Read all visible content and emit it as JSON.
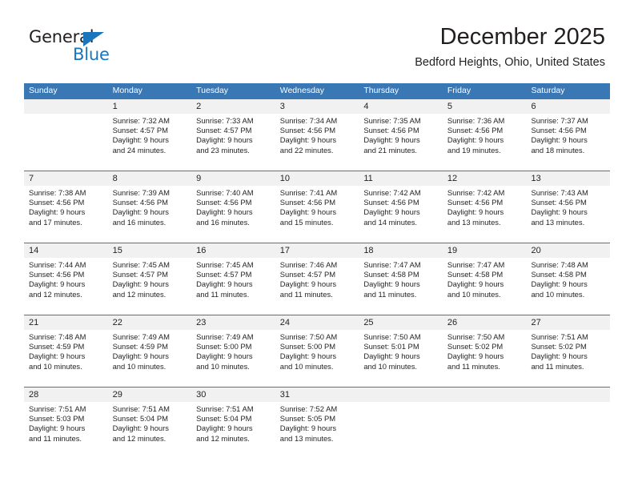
{
  "brand": {
    "name_part1": "General",
    "name_part2": "Blue"
  },
  "header": {
    "month_title": "December 2025",
    "location": "Bedford Heights, Ohio, United States"
  },
  "colors": {
    "header_blue": "#3a77b5",
    "brand_blue": "#1b75bc",
    "day_band_gray": "#f1f1f1",
    "text": "#231f20"
  },
  "calendar": {
    "day_headers": [
      "Sunday",
      "Monday",
      "Tuesday",
      "Wednesday",
      "Thursday",
      "Friday",
      "Saturday"
    ],
    "weeks": [
      [
        {
          "day": "",
          "sunrise": "",
          "sunset": "",
          "daylight_line1": "",
          "daylight_line2": ""
        },
        {
          "day": "1",
          "sunrise": "Sunrise: 7:32 AM",
          "sunset": "Sunset: 4:57 PM",
          "daylight_line1": "Daylight: 9 hours",
          "daylight_line2": "and 24 minutes."
        },
        {
          "day": "2",
          "sunrise": "Sunrise: 7:33 AM",
          "sunset": "Sunset: 4:57 PM",
          "daylight_line1": "Daylight: 9 hours",
          "daylight_line2": "and 23 minutes."
        },
        {
          "day": "3",
          "sunrise": "Sunrise: 7:34 AM",
          "sunset": "Sunset: 4:56 PM",
          "daylight_line1": "Daylight: 9 hours",
          "daylight_line2": "and 22 minutes."
        },
        {
          "day": "4",
          "sunrise": "Sunrise: 7:35 AM",
          "sunset": "Sunset: 4:56 PM",
          "daylight_line1": "Daylight: 9 hours",
          "daylight_line2": "and 21 minutes."
        },
        {
          "day": "5",
          "sunrise": "Sunrise: 7:36 AM",
          "sunset": "Sunset: 4:56 PM",
          "daylight_line1": "Daylight: 9 hours",
          "daylight_line2": "and 19 minutes."
        },
        {
          "day": "6",
          "sunrise": "Sunrise: 7:37 AM",
          "sunset": "Sunset: 4:56 PM",
          "daylight_line1": "Daylight: 9 hours",
          "daylight_line2": "and 18 minutes."
        }
      ],
      [
        {
          "day": "7",
          "sunrise": "Sunrise: 7:38 AM",
          "sunset": "Sunset: 4:56 PM",
          "daylight_line1": "Daylight: 9 hours",
          "daylight_line2": "and 17 minutes."
        },
        {
          "day": "8",
          "sunrise": "Sunrise: 7:39 AM",
          "sunset": "Sunset: 4:56 PM",
          "daylight_line1": "Daylight: 9 hours",
          "daylight_line2": "and 16 minutes."
        },
        {
          "day": "9",
          "sunrise": "Sunrise: 7:40 AM",
          "sunset": "Sunset: 4:56 PM",
          "daylight_line1": "Daylight: 9 hours",
          "daylight_line2": "and 16 minutes."
        },
        {
          "day": "10",
          "sunrise": "Sunrise: 7:41 AM",
          "sunset": "Sunset: 4:56 PM",
          "daylight_line1": "Daylight: 9 hours",
          "daylight_line2": "and 15 minutes."
        },
        {
          "day": "11",
          "sunrise": "Sunrise: 7:42 AM",
          "sunset": "Sunset: 4:56 PM",
          "daylight_line1": "Daylight: 9 hours",
          "daylight_line2": "and 14 minutes."
        },
        {
          "day": "12",
          "sunrise": "Sunrise: 7:42 AM",
          "sunset": "Sunset: 4:56 PM",
          "daylight_line1": "Daylight: 9 hours",
          "daylight_line2": "and 13 minutes."
        },
        {
          "day": "13",
          "sunrise": "Sunrise: 7:43 AM",
          "sunset": "Sunset: 4:56 PM",
          "daylight_line1": "Daylight: 9 hours",
          "daylight_line2": "and 13 minutes."
        }
      ],
      [
        {
          "day": "14",
          "sunrise": "Sunrise: 7:44 AM",
          "sunset": "Sunset: 4:56 PM",
          "daylight_line1": "Daylight: 9 hours",
          "daylight_line2": "and 12 minutes."
        },
        {
          "day": "15",
          "sunrise": "Sunrise: 7:45 AM",
          "sunset": "Sunset: 4:57 PM",
          "daylight_line1": "Daylight: 9 hours",
          "daylight_line2": "and 12 minutes."
        },
        {
          "day": "16",
          "sunrise": "Sunrise: 7:45 AM",
          "sunset": "Sunset: 4:57 PM",
          "daylight_line1": "Daylight: 9 hours",
          "daylight_line2": "and 11 minutes."
        },
        {
          "day": "17",
          "sunrise": "Sunrise: 7:46 AM",
          "sunset": "Sunset: 4:57 PM",
          "daylight_line1": "Daylight: 9 hours",
          "daylight_line2": "and 11 minutes."
        },
        {
          "day": "18",
          "sunrise": "Sunrise: 7:47 AM",
          "sunset": "Sunset: 4:58 PM",
          "daylight_line1": "Daylight: 9 hours",
          "daylight_line2": "and 11 minutes."
        },
        {
          "day": "19",
          "sunrise": "Sunrise: 7:47 AM",
          "sunset": "Sunset: 4:58 PM",
          "daylight_line1": "Daylight: 9 hours",
          "daylight_line2": "and 10 minutes."
        },
        {
          "day": "20",
          "sunrise": "Sunrise: 7:48 AM",
          "sunset": "Sunset: 4:58 PM",
          "daylight_line1": "Daylight: 9 hours",
          "daylight_line2": "and 10 minutes."
        }
      ],
      [
        {
          "day": "21",
          "sunrise": "Sunrise: 7:48 AM",
          "sunset": "Sunset: 4:59 PM",
          "daylight_line1": "Daylight: 9 hours",
          "daylight_line2": "and 10 minutes."
        },
        {
          "day": "22",
          "sunrise": "Sunrise: 7:49 AM",
          "sunset": "Sunset: 4:59 PM",
          "daylight_line1": "Daylight: 9 hours",
          "daylight_line2": "and 10 minutes."
        },
        {
          "day": "23",
          "sunrise": "Sunrise: 7:49 AM",
          "sunset": "Sunset: 5:00 PM",
          "daylight_line1": "Daylight: 9 hours",
          "daylight_line2": "and 10 minutes."
        },
        {
          "day": "24",
          "sunrise": "Sunrise: 7:50 AM",
          "sunset": "Sunset: 5:00 PM",
          "daylight_line1": "Daylight: 9 hours",
          "daylight_line2": "and 10 minutes."
        },
        {
          "day": "25",
          "sunrise": "Sunrise: 7:50 AM",
          "sunset": "Sunset: 5:01 PM",
          "daylight_line1": "Daylight: 9 hours",
          "daylight_line2": "and 10 minutes."
        },
        {
          "day": "26",
          "sunrise": "Sunrise: 7:50 AM",
          "sunset": "Sunset: 5:02 PM",
          "daylight_line1": "Daylight: 9 hours",
          "daylight_line2": "and 11 minutes."
        },
        {
          "day": "27",
          "sunrise": "Sunrise: 7:51 AM",
          "sunset": "Sunset: 5:02 PM",
          "daylight_line1": "Daylight: 9 hours",
          "daylight_line2": "and 11 minutes."
        }
      ],
      [
        {
          "day": "28",
          "sunrise": "Sunrise: 7:51 AM",
          "sunset": "Sunset: 5:03 PM",
          "daylight_line1": "Daylight: 9 hours",
          "daylight_line2": "and 11 minutes."
        },
        {
          "day": "29",
          "sunrise": "Sunrise: 7:51 AM",
          "sunset": "Sunset: 5:04 PM",
          "daylight_line1": "Daylight: 9 hours",
          "daylight_line2": "and 12 minutes."
        },
        {
          "day": "30",
          "sunrise": "Sunrise: 7:51 AM",
          "sunset": "Sunset: 5:04 PM",
          "daylight_line1": "Daylight: 9 hours",
          "daylight_line2": "and 12 minutes."
        },
        {
          "day": "31",
          "sunrise": "Sunrise: 7:52 AM",
          "sunset": "Sunset: 5:05 PM",
          "daylight_line1": "Daylight: 9 hours",
          "daylight_line2": "and 13 minutes."
        },
        {
          "day": "",
          "sunrise": "",
          "sunset": "",
          "daylight_line1": "",
          "daylight_line2": ""
        },
        {
          "day": "",
          "sunrise": "",
          "sunset": "",
          "daylight_line1": "",
          "daylight_line2": ""
        },
        {
          "day": "",
          "sunrise": "",
          "sunset": "",
          "daylight_line1": "",
          "daylight_line2": ""
        }
      ]
    ]
  }
}
